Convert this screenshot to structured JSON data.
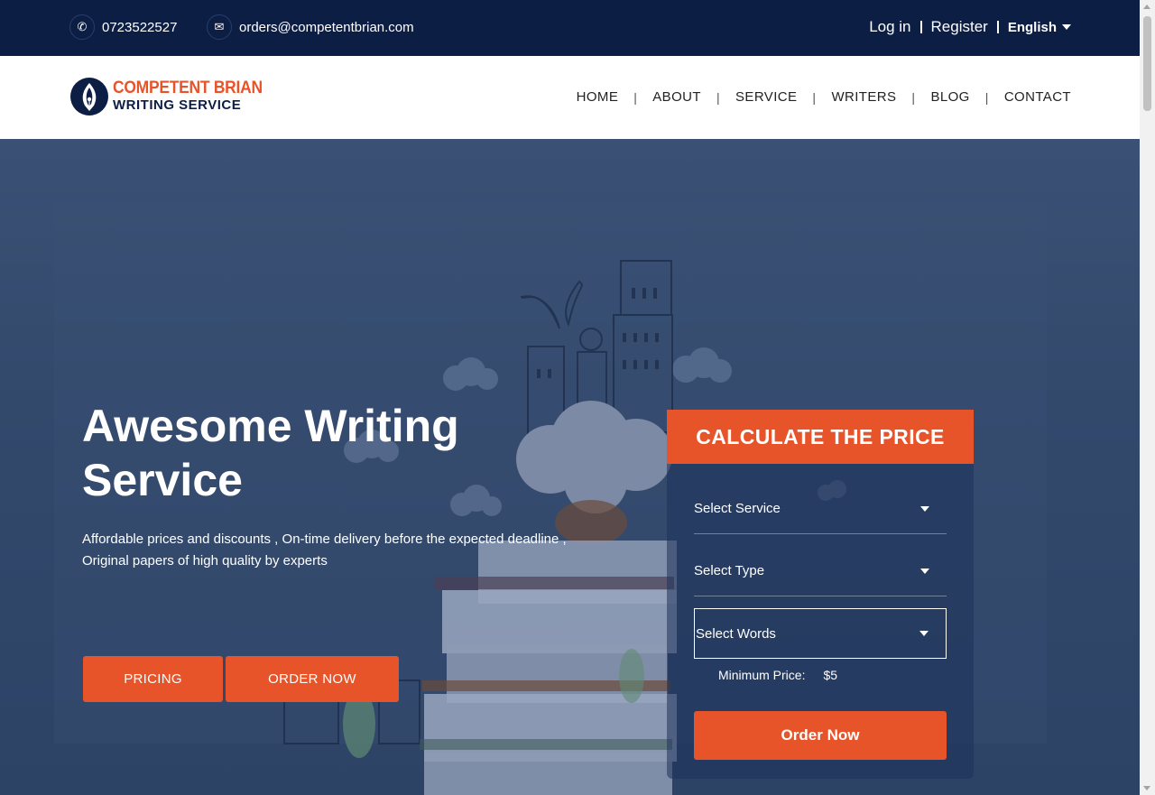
{
  "topbar": {
    "phone": "0723522527",
    "email": "orders@competentbrian.com",
    "login": "Log in",
    "register": "Register",
    "language": "English",
    "phone_icon": "phone-icon",
    "email_icon": "envelope-icon"
  },
  "header": {
    "logo_line1": "COMPETENT BRIAN",
    "logo_line2": "WRITING SERVICE",
    "nav": [
      "HOME",
      "ABOUT",
      "SERVICE",
      "WRITERS",
      "BLOG",
      "CONTACT"
    ]
  },
  "hero": {
    "title_line1": "Awesome Writing",
    "title_line2": "Service",
    "subtitle_line1": "Affordable prices and discounts , On-time delivery before the expected deadline ,",
    "subtitle_line2": "Original papers of high quality by experts",
    "pricing_button": "PRICING",
    "order_button": "ORDER NOW"
  },
  "calculator": {
    "title": "CALCULATE THE PRICE",
    "select_service": "Select Service",
    "select_type": "Select Type",
    "select_words": "Select Words",
    "min_price_label": "Minimum Price:",
    "min_price_value": "$5",
    "order_button": "Order Now"
  },
  "colors": {
    "navy": "#0d1e45",
    "accent": "#e8542a",
    "hero_bg": "#34496c"
  }
}
